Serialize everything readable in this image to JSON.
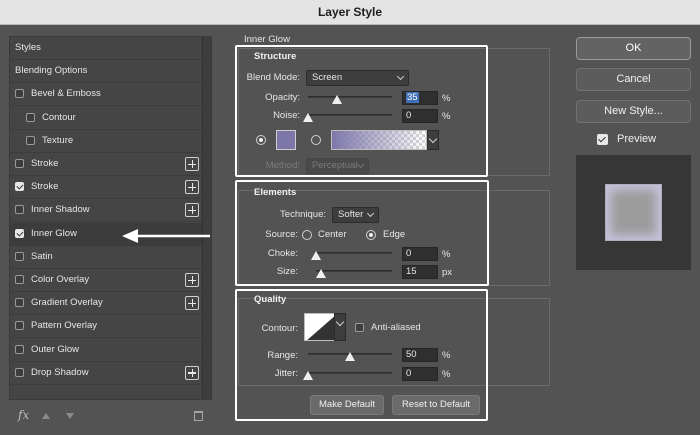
{
  "window": {
    "title": "Layer Style"
  },
  "left_panel": {
    "rows": [
      {
        "label": "Styles",
        "checkbox": false,
        "checked": false,
        "indent": 0,
        "plus": false,
        "selected": false
      },
      {
        "label": "Blending Options",
        "checkbox": false,
        "checked": false,
        "indent": 0,
        "plus": false,
        "selected": false
      },
      {
        "label": "Bevel & Emboss",
        "checkbox": true,
        "checked": false,
        "indent": 0,
        "plus": false,
        "selected": false
      },
      {
        "label": "Contour",
        "checkbox": true,
        "checked": false,
        "indent": 1,
        "plus": false,
        "selected": false
      },
      {
        "label": "Texture",
        "checkbox": true,
        "checked": false,
        "indent": 1,
        "plus": false,
        "selected": false
      },
      {
        "label": "Stroke",
        "checkbox": true,
        "checked": false,
        "indent": 0,
        "plus": true,
        "selected": false
      },
      {
        "label": "Stroke",
        "checkbox": true,
        "checked": true,
        "indent": 0,
        "plus": true,
        "selected": false
      },
      {
        "label": "Inner Shadow",
        "checkbox": true,
        "checked": false,
        "indent": 0,
        "plus": true,
        "selected": false
      },
      {
        "label": "Inner Glow",
        "checkbox": true,
        "checked": true,
        "indent": 0,
        "plus": false,
        "selected": true
      },
      {
        "label": "Satin",
        "checkbox": true,
        "checked": false,
        "indent": 0,
        "plus": false,
        "selected": false
      },
      {
        "label": "Color Overlay",
        "checkbox": true,
        "checked": false,
        "indent": 0,
        "plus": true,
        "selected": false
      },
      {
        "label": "Gradient Overlay",
        "checkbox": true,
        "checked": false,
        "indent": 0,
        "plus": true,
        "selected": false
      },
      {
        "label": "Pattern Overlay",
        "checkbox": true,
        "checked": false,
        "indent": 0,
        "plus": false,
        "selected": false
      },
      {
        "label": "Outer Glow",
        "checkbox": true,
        "checked": false,
        "indent": 0,
        "plus": false,
        "selected": false
      },
      {
        "label": "Drop Shadow",
        "checkbox": true,
        "checked": false,
        "indent": 0,
        "plus": true,
        "selected": false
      }
    ],
    "fx_label": "fx"
  },
  "inner_glow": {
    "section_title": "Inner Glow",
    "structure": {
      "title": "Structure",
      "blend_mode_label": "Blend Mode:",
      "blend_mode_value": "Screen",
      "opacity_label": "Opacity:",
      "opacity_value": "35",
      "opacity_unit": "%",
      "opacity_fraction": 0.35,
      "noise_label": "Noise:",
      "noise_value": "0",
      "noise_unit": "%",
      "noise_fraction": 0,
      "glow_color": "#7d77a9",
      "method_label": "Method:",
      "method_value": "Perceptual"
    },
    "elements": {
      "title": "Elements",
      "technique_label": "Technique:",
      "technique_value": "Softer",
      "source_label": "Source:",
      "source_center": "Center",
      "source_edge": "Edge",
      "choke_label": "Choke:",
      "choke_value": "0",
      "choke_unit": "%",
      "choke_fraction": 0,
      "size_label": "Size:",
      "size_value": "15",
      "size_unit": "px",
      "size_fraction": 0.06
    },
    "quality": {
      "title": "Quality",
      "contour_label": "Contour:",
      "anti_aliased_label": "Anti-aliased",
      "range_label": "Range:",
      "range_value": "50",
      "range_unit": "%",
      "range_fraction": 0.5,
      "jitter_label": "Jitter:",
      "jitter_value": "0",
      "jitter_unit": "%",
      "jitter_fraction": 0
    },
    "make_default_label": "Make Default",
    "reset_default_label": "Reset to Default"
  },
  "right_panel": {
    "ok_label": "OK",
    "cancel_label": "Cancel",
    "new_style_label": "New Style...",
    "preview_label": "Preview"
  }
}
